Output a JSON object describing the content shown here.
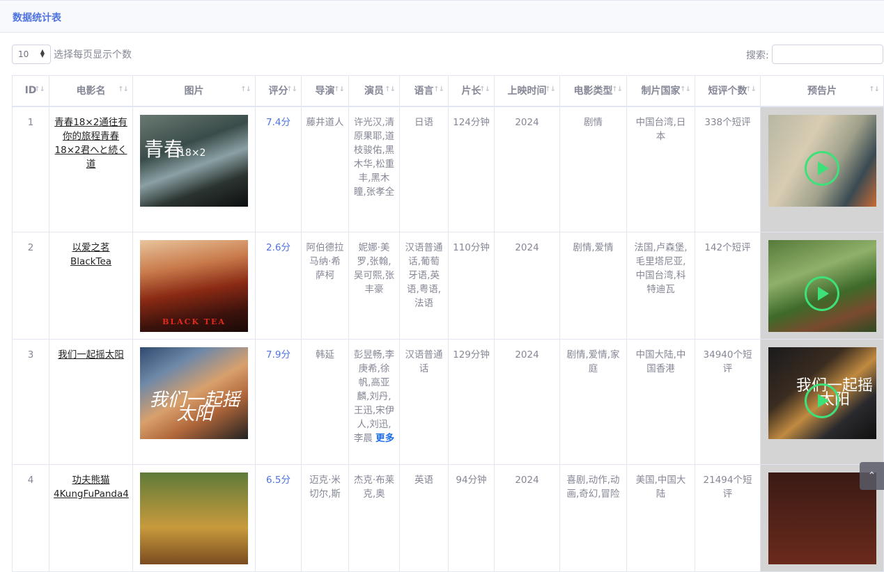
{
  "header": {
    "title": "数据统计表"
  },
  "length_control": {
    "value": "10",
    "label": "选择每页显示个数"
  },
  "search": {
    "label": "搜索:",
    "value": ""
  },
  "columns": [
    "ID",
    "电影名",
    "图片",
    "评分",
    "导演",
    "演员",
    "语言",
    "片长",
    "上映时间",
    "电影类型",
    "制片国家",
    "短评个数",
    "预告片"
  ],
  "rows": [
    {
      "id": "1",
      "name": "青春18×2通往有你的旅程青春18×2君へと続く道",
      "poster_text": "青春",
      "poster_num": "18×2",
      "score": "7.4分",
      "director": "藤井道人",
      "actors": "许光汉,清原果耶,道枝骏佑,黑木华,松重丰,黑木瞳,张孝全",
      "language": "日语",
      "duration": "124分钟",
      "year": "2024",
      "genre": "剧情",
      "country": "中国台湾,日本",
      "reviews": "338个短评"
    },
    {
      "id": "2",
      "name": "以爱之茗",
      "name_en": "BlackTea",
      "poster_text": "BLACK TEA",
      "score": "2.6分",
      "director": "阿伯德拉马纳·希萨柯",
      "actors": "妮娜·美罗,张翰,吴可熙,张丰豪",
      "language": "汉语普通话,葡萄牙语,英语,粤语,法语",
      "duration": "110分钟",
      "year": "2024",
      "genre": "剧情,爱情",
      "country": "法国,卢森堡,毛里塔尼亚,中国台湾,科特迪瓦",
      "reviews": "142个短评"
    },
    {
      "id": "3",
      "name": "我们一起摇太阳",
      "poster_text": "我们一起摇太阳",
      "trailer_text": "我们一起摇太阳",
      "score": "7.9分",
      "director": "韩延",
      "actors": "彭昱畅,李庚希,徐帆,高亚麟,刘丹,王迅,宋伊人,刘迅,李晨",
      "more": "更多",
      "language": "汉语普通话",
      "duration": "129分钟",
      "year": "2024",
      "genre": "剧情,爱情,家庭",
      "country": "中国大陆,中国香港",
      "reviews": "34940个短评"
    },
    {
      "id": "4",
      "name": "功夫熊猫",
      "name_en": "4KungFuPanda4",
      "score": "6.5分",
      "director": "迈克·米切尔,斯",
      "actors": "杰克·布莱克,奥",
      "language": "英语",
      "duration": "94分钟",
      "year": "2024",
      "genre": "喜剧,动作,动画,奇幻,冒险",
      "country": "美国,中国大陆",
      "reviews": "21494个短评"
    }
  ],
  "colors": {
    "accent": "#4e73df",
    "link": "#1e6fe8",
    "play": "#3ee07a"
  },
  "icons": [
    "sort-icon",
    "play-icon",
    "chevron-up-icon"
  ]
}
